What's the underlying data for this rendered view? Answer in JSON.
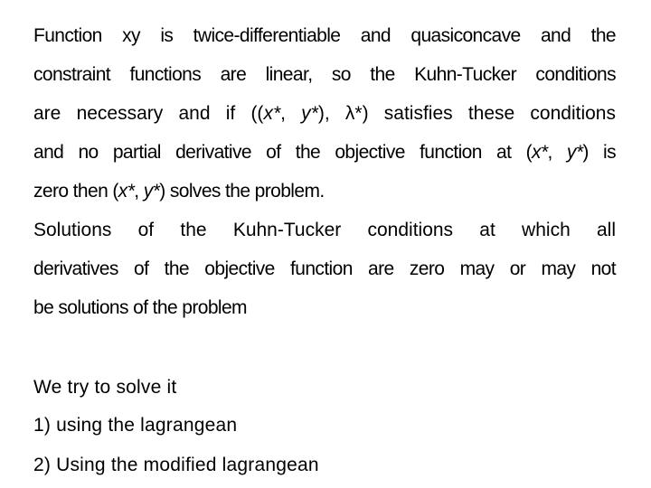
{
  "paragraph1": {
    "line1": "Function xy is twice-differentiable and quasiconcave and the",
    "line2": "constraint functions are linear, so the Kuhn-Tucker conditions",
    "line3": {
      "pre": "are necessary and if ((",
      "x": "x*",
      "sep1": ", ",
      "y": "y*",
      "mid": "), λ*) satisfies these conditions"
    },
    "line4": {
      "pre": "and no partial derivative of the objective function at (",
      "x": "x*",
      "sep1": ", ",
      "y": "y*",
      "post": ") is"
    },
    "line5": {
      "pre": "zero then (",
      "x": "x*",
      "sep1": ", ",
      "y": "y*",
      "post": ") solves the problem."
    }
  },
  "paragraph2": {
    "line1": "Solutions of the Kuhn-Tucker conditions at which all",
    "line2": "derivatives of the objective function are zero may or may not",
    "line3": "be solutions of the problem"
  },
  "approach": {
    "intro": "We try to solve it",
    "items": [
      "1) using the lagrangean",
      "2) Using the modified lagrangean"
    ]
  }
}
